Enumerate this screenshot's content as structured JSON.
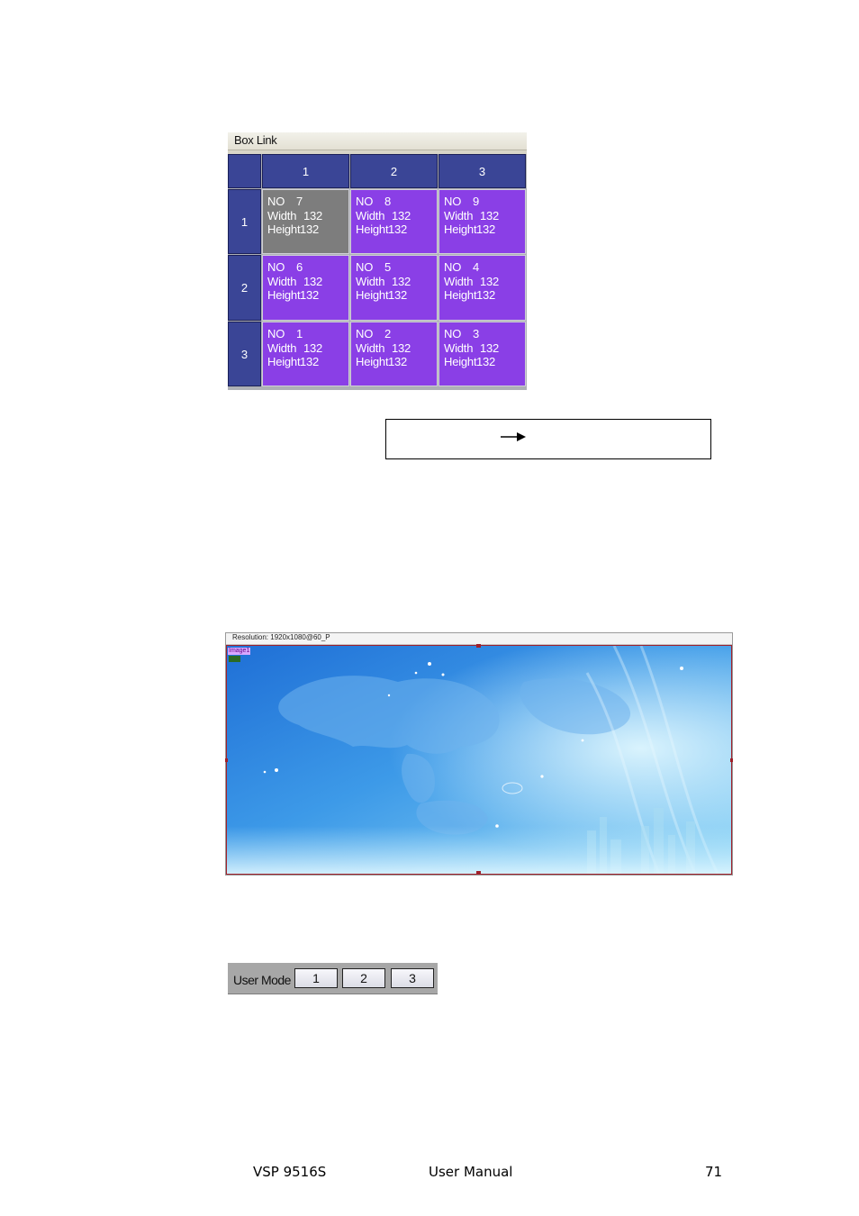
{
  "box_link": {
    "title": "Box Link",
    "column_headers": [
      "1",
      "2",
      "3"
    ],
    "row_headers": [
      "1",
      "2",
      "3"
    ],
    "rows": [
      [
        {
          "no_label": "NO",
          "no": "7",
          "width_label": "Width",
          "width": "132",
          "height_label": "Height",
          "height": "132",
          "selected": true
        },
        {
          "no_label": "NO",
          "no": "8",
          "width_label": "Width",
          "width": "132",
          "height_label": "Height",
          "height": "132",
          "selected": false
        },
        {
          "no_label": "NO",
          "no": "9",
          "width_label": "Width",
          "width": "132",
          "height_label": "Height",
          "height": "132",
          "selected": false
        }
      ],
      [
        {
          "no_label": "NO",
          "no": "6",
          "width_label": "Width",
          "width": "132",
          "height_label": "Height",
          "height": "132",
          "selected": false
        },
        {
          "no_label": "NO",
          "no": "5",
          "width_label": "Width",
          "width": "132",
          "height_label": "Height",
          "height": "132",
          "selected": false
        },
        {
          "no_label": "NO",
          "no": "4",
          "width_label": "Width",
          "width": "132",
          "height_label": "Height",
          "height": "132",
          "selected": false
        }
      ],
      [
        {
          "no_label": "NO",
          "no": "1",
          "width_label": "Width",
          "width": "132",
          "height_label": "Height",
          "height": "132",
          "selected": false
        },
        {
          "no_label": "NO",
          "no": "2",
          "width_label": "Width",
          "width": "132",
          "height_label": "Height",
          "height": "132",
          "selected": false
        },
        {
          "no_label": "NO",
          "no": "3",
          "width_label": "Width",
          "width": "132",
          "height_label": "Height",
          "height": "132",
          "selected": false
        }
      ]
    ],
    "colors": {
      "header": "#3a4596",
      "cell": "#8a3fe6",
      "selected_cell": "#7d7d7d"
    }
  },
  "callout": {
    "icon": "right-arrow-icon"
  },
  "preview": {
    "resolution_text": "Resolution: 1920x1080@60_P",
    "image_label": "Image1",
    "colors": {
      "frame": "#a0202a"
    }
  },
  "user_mode": {
    "label": "User Mode",
    "buttons": [
      "1",
      "2",
      "3"
    ]
  },
  "footer": {
    "model": "VSP 9516S",
    "doc": "User Manual",
    "page": "71"
  }
}
